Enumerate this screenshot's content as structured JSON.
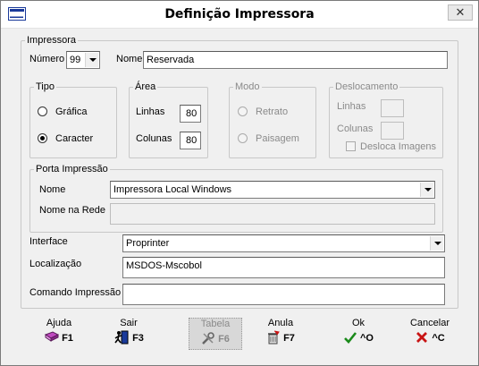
{
  "window": {
    "title": "Definição Impressora",
    "close_glyph": "✕"
  },
  "impressora": {
    "legend": "Impressora",
    "numero_label": "Número",
    "numero_value": "99",
    "nome_label": "Nome",
    "nome_value": "Reservada"
  },
  "tipo": {
    "legend": "Tipo",
    "options": [
      {
        "label": "Gráfica",
        "selected": false
      },
      {
        "label": "Caracter",
        "selected": true
      }
    ]
  },
  "area": {
    "legend": "Área",
    "linhas_label": "Linhas",
    "linhas_value": "80",
    "colunas_label": "Colunas",
    "colunas_value": "80"
  },
  "modo": {
    "legend": "Modo",
    "options": [
      {
        "label": "Retrato"
      },
      {
        "label": "Paisagem"
      }
    ]
  },
  "deslocamento": {
    "legend": "Deslocamento",
    "linhas_label": "Linhas",
    "colunas_label": "Colunas",
    "checkbox_label": "Desloca Imagens"
  },
  "porta": {
    "legend": "Porta Impressão",
    "nome_label": "Nome",
    "nome_value": "Impressora Local Windows",
    "rede_label": "Nome na Rede",
    "rede_value": ""
  },
  "interface": {
    "label": "Interface",
    "value": "Proprinter"
  },
  "localizacao": {
    "label": "Localização",
    "value": "MSDOS-Mscobol"
  },
  "comando": {
    "label": "Comando Impressão",
    "value": ""
  },
  "buttons": [
    {
      "label": "Ajuda",
      "key": "F1",
      "icon": "book-icon"
    },
    {
      "label": "Sair",
      "key": "F3",
      "icon": "exit-icon"
    },
    {
      "label": "Tabela",
      "key": "F6",
      "icon": "tools-icon"
    },
    {
      "label": "Anula",
      "key": "F7",
      "icon": "trash-icon"
    },
    {
      "label": "Ok",
      "key": "^O",
      "icon": "check-icon"
    },
    {
      "label": "Cancelar",
      "key": "^C",
      "icon": "x-icon"
    }
  ],
  "colors": {
    "check_green": "#1a8a1a",
    "cancel_red": "#c81414",
    "icon_blue": "#1a3a9a"
  }
}
